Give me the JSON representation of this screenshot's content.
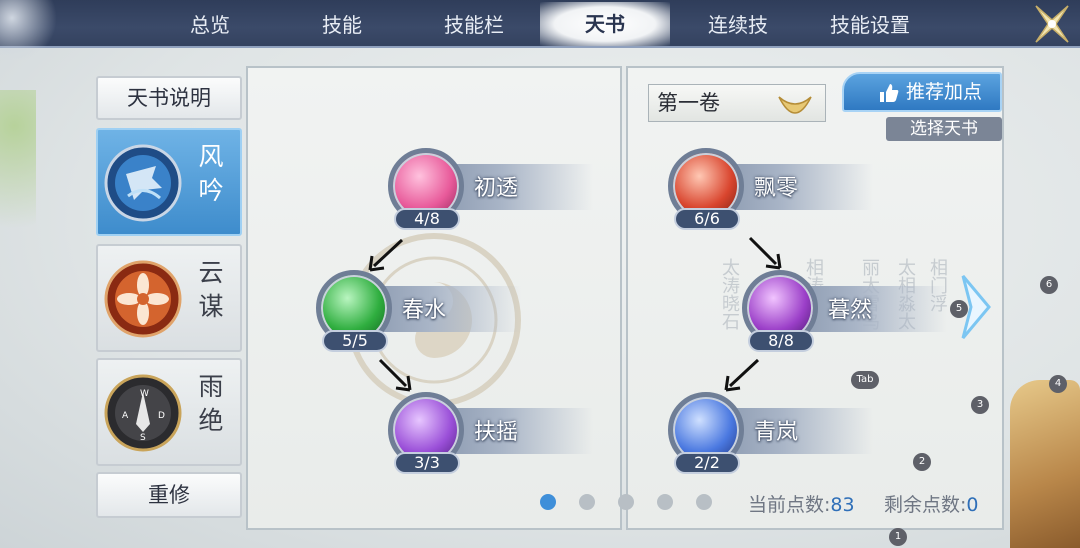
{
  "tabs": [
    "总览",
    "技能",
    "技能栏",
    "天书",
    "连续技",
    "技能设置"
  ],
  "active_tab": "天书",
  "sidebar": {
    "info_button": "天书说明",
    "books": [
      {
        "name": "风吟",
        "name_top": "风",
        "name_bottom": "吟",
        "active": true
      },
      {
        "name": "云谋",
        "name_top": "云",
        "name_bottom": "谋",
        "active": false
      },
      {
        "name": "雨绝",
        "name_top": "雨",
        "name_bottom": "绝",
        "active": false
      }
    ],
    "reset_button": "重修"
  },
  "left_tree": [
    {
      "name": "初透",
      "level": "4/8",
      "color": "#e85a9a"
    },
    {
      "name": "春水",
      "level": "5/5",
      "color": "#2fae3f"
    },
    {
      "name": "扶摇",
      "level": "3/3",
      "color": "#9a4fd8"
    }
  ],
  "right_panel": {
    "volume": "第一卷",
    "recommend_button": "推荐加点",
    "choose_button": "选择天书",
    "tree": [
      {
        "name": "飘零",
        "level": "6/6",
        "color": "#d9452e"
      },
      {
        "name": "暮然",
        "level": "8/8",
        "color": "#9b3fc8"
      },
      {
        "name": "青岚",
        "level": "2/2",
        "color": "#4a78e0"
      }
    ]
  },
  "pagination": {
    "count": 5,
    "active_index": 0
  },
  "points": {
    "current_label": "当前点数:",
    "current_value": "83",
    "remaining_label": "剩余点数:",
    "remaining_value": "0"
  },
  "markers": {
    "m1": "1",
    "m2": "2",
    "m3": "3",
    "m4": "4",
    "m5": "5",
    "m6": "6",
    "tab_key": "Tab"
  },
  "calligraphy": [
    "太涛晓石",
    "相涛浣白",
    "丽太雪乌",
    "太相淼太",
    "相门浮"
  ]
}
